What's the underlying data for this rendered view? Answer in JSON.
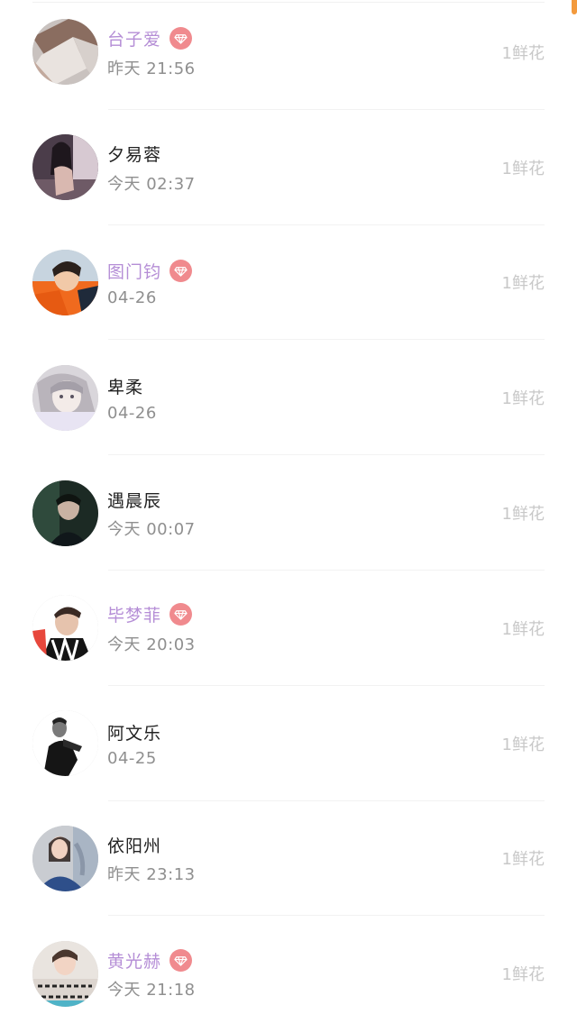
{
  "colors": {
    "vip_name": "#b58ed6",
    "normal_name": "#222222",
    "time_text": "#8f8f8f",
    "gift_text": "#c8c8c8",
    "badge": "#f08a8e",
    "scroll_indicator": "#f39a3d"
  },
  "records": [
    {
      "name": "台子爱",
      "time": "昨天 21:56",
      "gift": "1鲜花",
      "vip": true,
      "avatar_icon": "origami-photo-avatar"
    },
    {
      "name": "夕易蓉",
      "time": "今天 02:37",
      "gift": "1鲜花",
      "vip": false,
      "avatar_icon": "woman-photo-avatar"
    },
    {
      "name": "图门钧",
      "time": "04-26",
      "gift": "1鲜花",
      "vip": true,
      "avatar_icon": "boy-orange-photo-avatar"
    },
    {
      "name": "卑柔",
      "time": "04-26",
      "gift": "1鲜花",
      "vip": false,
      "avatar_icon": "anime-girl-avatar"
    },
    {
      "name": "遇晨辰",
      "time": "今天 00:07",
      "gift": "1鲜花",
      "vip": false,
      "avatar_icon": "man-dark-photo-avatar"
    },
    {
      "name": "毕梦菲",
      "time": "今天 20:03",
      "gift": "1鲜花",
      "vip": true,
      "avatar_icon": "man-scarf-photo-avatar"
    },
    {
      "name": "阿文乐",
      "time": "04-25",
      "gift": "1鲜花",
      "vip": false,
      "avatar_icon": "bw-portrait-avatar"
    },
    {
      "name": "依阳州",
      "time": "昨天 23:13",
      "gift": "1鲜花",
      "vip": false,
      "avatar_icon": "woman-blue-photo-avatar"
    },
    {
      "name": "黄光赫",
      "time": "今天 21:18",
      "gift": "1鲜花",
      "vip": true,
      "avatar_icon": "calligraphy-photo-avatar"
    }
  ]
}
